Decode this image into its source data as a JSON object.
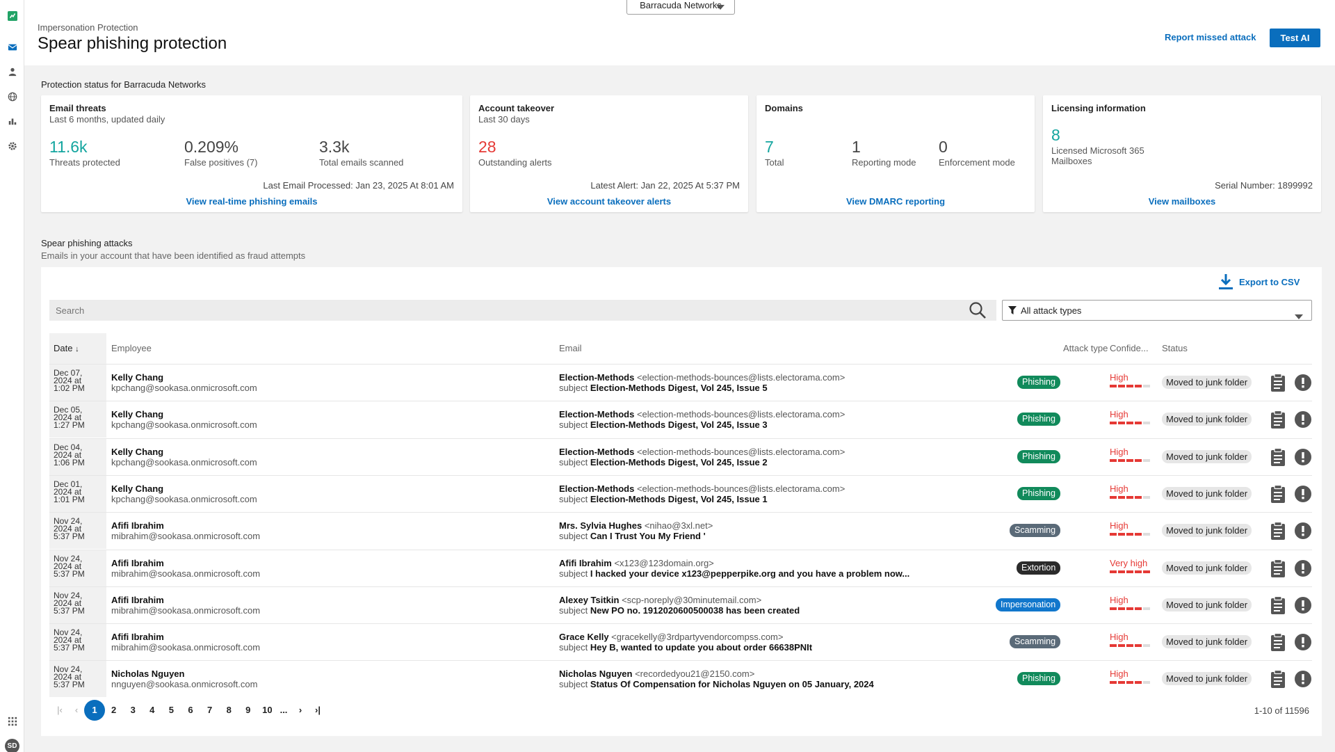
{
  "colors": {
    "accent": "#0a6ebd",
    "teal": "#13a59f",
    "red": "#e53935",
    "phishing": "#118a5b",
    "scamming": "#5a6a78",
    "extortion": "#2b2b2b",
    "impersonation": "#1177cc"
  },
  "rail": {
    "icons": [
      "app-logo-icon",
      "mail-icon",
      "user-icon",
      "globe-icon",
      "bar-chart-icon",
      "gear-icon",
      "apps-grid-icon"
    ],
    "avatar": "SD"
  },
  "header": {
    "tenant": "Barracuda Networks",
    "breadcrumb": "Impersonation Protection",
    "title": "Spear phishing protection",
    "report_link": "Report missed attack",
    "test_ai": "Test AI"
  },
  "protection": {
    "title": "Protection status for Barracuda Networks",
    "cards": {
      "email_threats": {
        "title": "Email threats",
        "subtitle": "Last 6 months, updated daily",
        "stats": [
          {
            "value": "11.6k",
            "label": "Threats protected"
          },
          {
            "value": "0.209%",
            "label": "False positives (7)"
          },
          {
            "value": "3.3k",
            "label": "Total emails scanned"
          }
        ],
        "footer": "Last Email Processed: Jan 23, 2025 At 8:01 AM",
        "link": "View real-time phishing emails"
      },
      "account_takeover": {
        "title": "Account takeover",
        "subtitle": "Last 30 days",
        "stats": [
          {
            "value": "28",
            "label": "Outstanding alerts"
          }
        ],
        "footer": "Latest Alert: Jan 22, 2025 At 5:37 PM",
        "link": "View account takeover alerts"
      },
      "domains": {
        "title": "Domains",
        "stats": [
          {
            "value": "7",
            "label": "Total"
          },
          {
            "value": "1",
            "label": "Reporting mode"
          },
          {
            "value": "0",
            "label": "Enforcement mode"
          }
        ],
        "link": "View DMARC reporting"
      },
      "licensing": {
        "title": "Licensing information",
        "stats": [
          {
            "value": "8",
            "label_line1": "Licensed Microsoft 365",
            "label_line2": "Mailboxes"
          }
        ],
        "footer": "Serial Number: 1899992",
        "link": "View mailboxes"
      }
    }
  },
  "attacks": {
    "title": "Spear phishing attacks",
    "subtitle": "Emails in your account that have been identified as fraud attempts",
    "export": "Export to CSV",
    "search_placeholder": "Search",
    "filter": "All attack types",
    "columns": {
      "date": "Date",
      "sort": "↓",
      "employee": "Employee",
      "email": "Email",
      "attack_type": "Attack type",
      "confidence": "Confide...",
      "status": "Status"
    },
    "subject_prefix": "subject",
    "rows": [
      {
        "date1": "Dec 07,",
        "date2": "2024 at",
        "date3": "1:02 PM",
        "name": "Kelly Chang",
        "mail": "kpchang@sookasa.onmicrosoft.com",
        "sender": "Election-Methods",
        "sender_addr": "<election-methods-bounces@lists.electorama.com>",
        "subject": "Election-Methods Digest, Vol 245, Issue 5",
        "type": "Phishing",
        "confidence": "High",
        "conf_level": 4,
        "status": "Moved to junk folder"
      },
      {
        "date1": "Dec 05,",
        "date2": "2024 at",
        "date3": "1:27 PM",
        "name": "Kelly Chang",
        "mail": "kpchang@sookasa.onmicrosoft.com",
        "sender": "Election-Methods",
        "sender_addr": "<election-methods-bounces@lists.electorama.com>",
        "subject": "Election-Methods Digest, Vol 245, Issue 3",
        "type": "Phishing",
        "confidence": "High",
        "conf_level": 4,
        "status": "Moved to junk folder"
      },
      {
        "date1": "Dec 04,",
        "date2": "2024 at",
        "date3": "1:06 PM",
        "name": "Kelly Chang",
        "mail": "kpchang@sookasa.onmicrosoft.com",
        "sender": "Election-Methods",
        "sender_addr": "<election-methods-bounces@lists.electorama.com>",
        "subject": "Election-Methods Digest, Vol 245, Issue 2",
        "type": "Phishing",
        "confidence": "High",
        "conf_level": 4,
        "status": "Moved to junk folder"
      },
      {
        "date1": "Dec 01,",
        "date2": "2024 at",
        "date3": "1:01 PM",
        "name": "Kelly Chang",
        "mail": "kpchang@sookasa.onmicrosoft.com",
        "sender": "Election-Methods",
        "sender_addr": "<election-methods-bounces@lists.electorama.com>",
        "subject": "Election-Methods Digest, Vol 245, Issue 1",
        "type": "Phishing",
        "confidence": "High",
        "conf_level": 4,
        "status": "Moved to junk folder"
      },
      {
        "date1": "Nov 24,",
        "date2": "2024 at",
        "date3": "5:37 PM",
        "name": "Afifi Ibrahim",
        "mail": "mibrahim@sookasa.onmicrosoft.com",
        "sender": "Mrs. Sylvia Hughes",
        "sender_addr": "<nihao@3xl.net>",
        "subject": "Can I Trust You My Friend '",
        "type": "Scamming",
        "confidence": "High",
        "conf_level": 4,
        "status": "Moved to junk folder"
      },
      {
        "date1": "Nov 24,",
        "date2": "2024 at",
        "date3": "5:37 PM",
        "name": "Afifi Ibrahim",
        "mail": "mibrahim@sookasa.onmicrosoft.com",
        "sender": "Afifi Ibrahim",
        "sender_addr": "<x123@123domain.org>",
        "subject": "I hacked your device x123@pepperpike.org and you have a problem now...",
        "type": "Extortion",
        "confidence": "Very high",
        "conf_level": 5,
        "status": "Moved to junk folder"
      },
      {
        "date1": "Nov 24,",
        "date2": "2024 at",
        "date3": "5:37 PM",
        "name": "Afifi Ibrahim",
        "mail": "mibrahim@sookasa.onmicrosoft.com",
        "sender": "Alexey Tsitkin",
        "sender_addr": "<scp-noreply@30minutemail.com>",
        "subject": "New PO no. 1912020600500038 has been created",
        "type": "Impersonation",
        "confidence": "High",
        "conf_level": 4,
        "status": "Moved to junk folder"
      },
      {
        "date1": "Nov 24,",
        "date2": "2024 at",
        "date3": "5:37 PM",
        "name": "Afifi Ibrahim",
        "mail": "mibrahim@sookasa.onmicrosoft.com",
        "sender": "Grace Kelly",
        "sender_addr": "<gracekelly@3rdpartyvendorcompss.com>",
        "subject": "Hey B, wanted to update you about order 66638PNIt",
        "type": "Scamming",
        "confidence": "High",
        "conf_level": 4,
        "status": "Moved to junk folder"
      },
      {
        "date1": "Nov 24,",
        "date2": "2024 at",
        "date3": "5:37 PM",
        "name": "Nicholas Nguyen",
        "mail": "nnguyen@sookasa.onmicrosoft.com",
        "sender": "Nicholas Nguyen",
        "sender_addr": "<recordedyou21@2150.com>",
        "subject": "Status Of Compensation for Nicholas Nguyen on 05 January, 2024",
        "type": "Phishing",
        "confidence": "High",
        "conf_level": 4,
        "status": "Moved to junk folder"
      }
    ],
    "pagination": {
      "pages": [
        "1",
        "2",
        "3",
        "4",
        "5",
        "6",
        "7",
        "8",
        "9",
        "10"
      ],
      "current": "1",
      "ellipsis": "...",
      "range": "1-10 of 11596"
    }
  }
}
